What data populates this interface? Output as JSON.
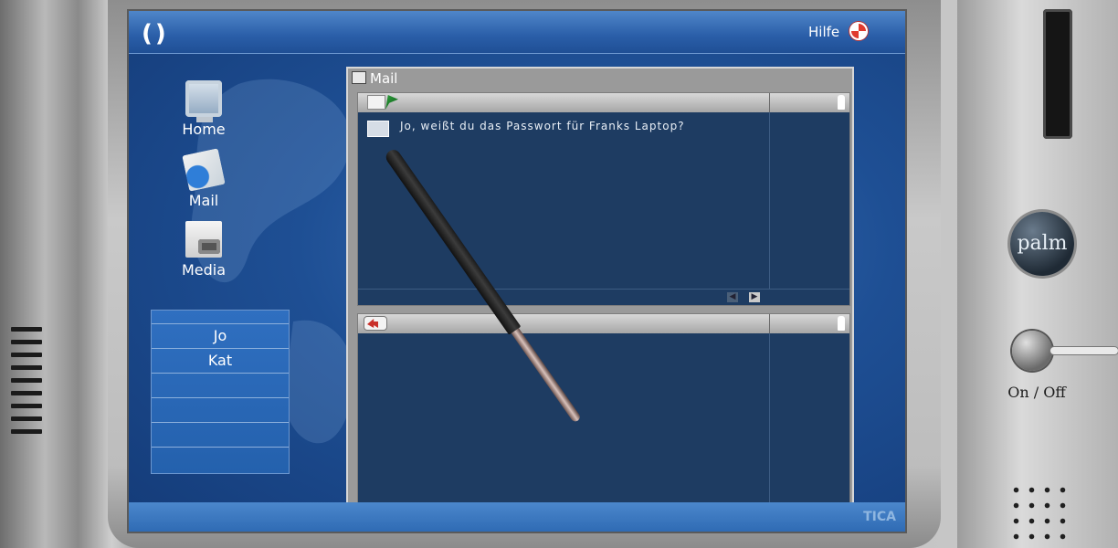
{
  "screen": {
    "help_label": "Hilfe",
    "bottom_text": "TICA"
  },
  "launcher": [
    {
      "label": "Home",
      "icon": "monitor-icon"
    },
    {
      "label": "Mail",
      "icon": "mail-icon"
    },
    {
      "label": "Media",
      "icon": "media-icon"
    }
  ],
  "contacts": [
    "",
    "Jo",
    "Kat",
    "",
    "",
    "",
    ""
  ],
  "mail_window": {
    "title": "Mail",
    "inbox": {
      "messages": [
        {
          "subject": "Jo, weißt du das Passwort für Franks Laptop?"
        }
      ]
    }
  },
  "device": {
    "brand": "palm",
    "power_label": "On / Off"
  },
  "colors": {
    "screen_bg": "#1e4f94",
    "pane_bg": "#1e3c62",
    "window_frame": "#9a9a9a"
  }
}
